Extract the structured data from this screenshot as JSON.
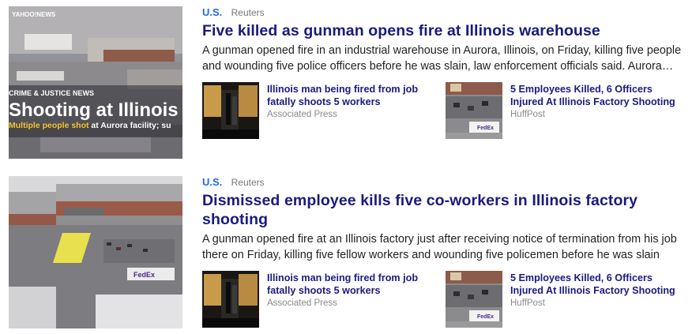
{
  "stories": [
    {
      "category": "U.S.",
      "source": "Reuters",
      "title": "Five killed as gunman opens fire at Illinois warehouse",
      "summary": "A gunman opened fire in an industrial warehouse in Aurora, Illinois, on Friday, killing five people and wounding five police officers before he was slain, law enforcement officials said. Aurora…",
      "thumb_overlay": {
        "brand": "YAHOO!NEWS",
        "kicker": "CRIME & JUSTICE NEWS",
        "headline": "Shooting at Illinois",
        "sub_highlight": "Multiple people shot",
        "sub_rest": " at Aurora facility; su"
      },
      "related": [
        {
          "title": "Illinois man being fired from job fatally shoots 5 workers",
          "source": "Associated Press"
        },
        {
          "title": "5 Employees Killed, 6 Officers Injured At Illinois Factory Shooting",
          "source": "HuffPost"
        }
      ]
    },
    {
      "category": "U.S.",
      "source": "Reuters",
      "title": "Dismissed employee kills five co-workers in Illinois factory shooting",
      "summary": "A gunman opened fire at an Illinois factory just after receiving notice of termination from his job there on Friday, killing five fellow workers and wounding five policemen before he was slain by…",
      "related": [
        {
          "title": "Illinois man being fired from job fatally shoots 5 workers",
          "source": "Associated Press"
        },
        {
          "title": "5 Employees Killed, 6 Officers Injured At Illinois Factory Shooting",
          "source": "HuffPost"
        }
      ]
    }
  ]
}
